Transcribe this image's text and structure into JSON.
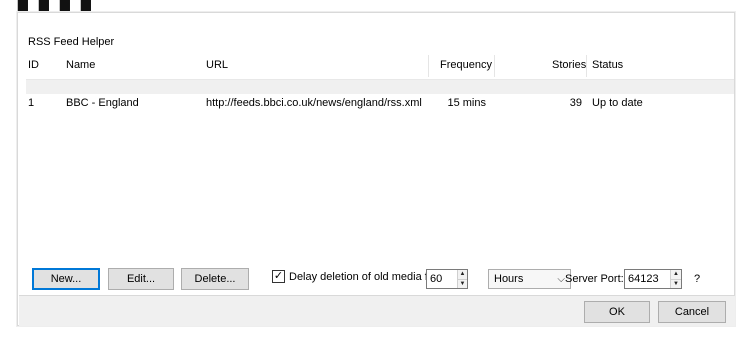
{
  "window": {
    "title": "RSS Feed Helper"
  },
  "columns": [
    "ID",
    "Name",
    "URL",
    "Frequency",
    "Stories",
    "Status"
  ],
  "rows": [
    {
      "id": "1",
      "name": "BBC - England",
      "url": "http://feeds.bbci.co.uk/news/england/rss.xml",
      "frequency": "15 mins",
      "stories": "39",
      "status": "Up to date"
    }
  ],
  "buttons": {
    "new": "New...",
    "edit": "Edit...",
    "delete": "Delete...",
    "ok": "OK",
    "cancel": "Cancel"
  },
  "delay": {
    "label": "Delay deletion of old media for",
    "checked": true,
    "value": "60",
    "unit": "Hours"
  },
  "server": {
    "label": "Server Port:",
    "value": "64123"
  },
  "help": "?",
  "colors": {
    "accent": "#0078d7",
    "button_face": "#e1e1e1",
    "footer": "#f0f0f0"
  }
}
